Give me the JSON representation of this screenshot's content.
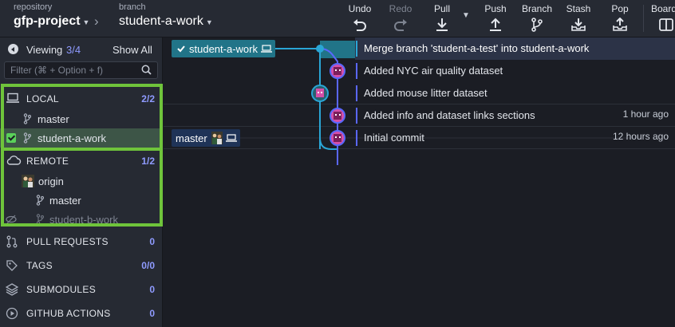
{
  "toolbar": {
    "repo_label": "repository",
    "repo_name": "gfp-project",
    "branch_label": "branch",
    "branch_name": "student-a-work",
    "actions": [
      {
        "label": "Undo",
        "icon": "undo-icon",
        "enabled": true
      },
      {
        "label": "Redo",
        "icon": "redo-icon",
        "enabled": false
      },
      {
        "label": "Pull",
        "icon": "pull-icon",
        "enabled": true
      },
      {
        "label": "Push",
        "icon": "push-icon",
        "enabled": true
      },
      {
        "label": "Branch",
        "icon": "branch-icon",
        "enabled": true
      },
      {
        "label": "Stash",
        "icon": "stash-icon",
        "enabled": true
      },
      {
        "label": "Pop",
        "icon": "pop-icon",
        "enabled": true
      },
      {
        "label": "Board",
        "icon": "board-icon",
        "enabled": true
      }
    ]
  },
  "sidebar": {
    "viewing_label": "Viewing",
    "viewing_count": "3/4",
    "show_all": "Show All",
    "filter_placeholder": "Filter (⌘ + Option + f)",
    "local": {
      "title": "LOCAL",
      "count_a": "2",
      "count_b": "2",
      "branches": [
        "master",
        "student-a-work"
      ]
    },
    "remote": {
      "title": "REMOTE",
      "count_a": "1",
      "count_b": "2",
      "origin": "origin",
      "branches": [
        "master",
        "student-b-work"
      ]
    },
    "pull_requests": {
      "title": "PULL REQUESTS",
      "count": "0"
    },
    "tags": {
      "title": "TAGS",
      "count_a": "0",
      "count_b": "0"
    },
    "submodules": {
      "title": "SUBMODULES",
      "count": "0"
    },
    "github_actions": {
      "title": "GITHUB ACTIONS",
      "count": "0"
    }
  },
  "graph": {
    "refs": {
      "head_branch": "student-a-work",
      "master": "master"
    },
    "commits": [
      {
        "message": "Merge branch 'student-a-test' into student-a-work",
        "time": ""
      },
      {
        "message": "Added NYC air quality dataset",
        "time": ""
      },
      {
        "message": "Added mouse litter dataset",
        "time": ""
      },
      {
        "message": "Added info and dataset links sections",
        "time": "1 hour ago"
      },
      {
        "message": "Initial commit",
        "time": "12 hours ago"
      }
    ]
  },
  "colors": {
    "accent": "#5a67ff",
    "highlight_outline": "#6fc43b",
    "branch_line": "#2aa6d6",
    "head_chip": "#217488",
    "master_chip": "#1f3357"
  }
}
